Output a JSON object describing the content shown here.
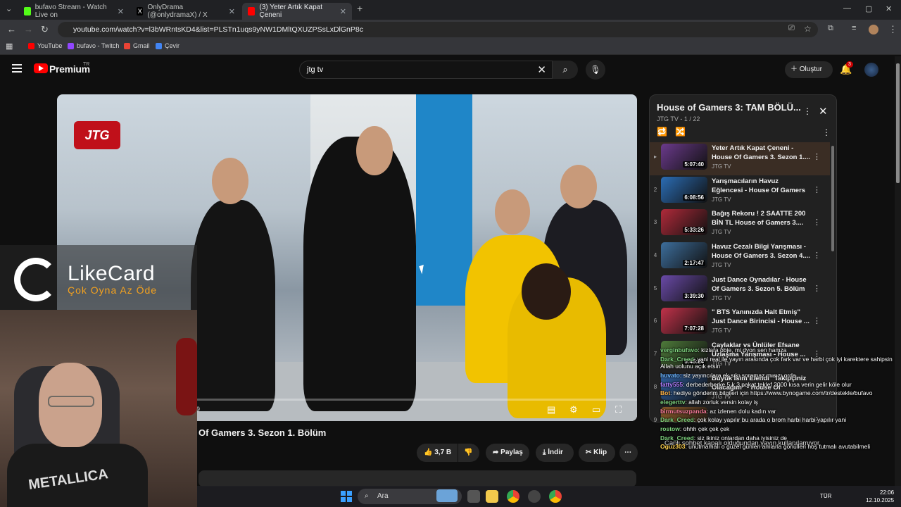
{
  "browser": {
    "tabs": [
      {
        "title": "bufavo Stream - Watch Live on",
        "color": "#53fc18"
      },
      {
        "title": "OnlyDrama (@onlydramaX) / X",
        "color": "#ffffff"
      },
      {
        "title": "(3) Yeter Artık Kapat Çeneni",
        "color": "#ff0000"
      }
    ],
    "url": "youtube.com/watch?v=l3bWRntsKD4&list=PLSTn1uqs9yNW1DMltQXUZPSsLxDlGnP8c",
    "bookmarks": [
      {
        "label": "YouTube",
        "color": "#ff0000"
      },
      {
        "label": "bufavo - Twitch",
        "color": "#9146ff"
      },
      {
        "label": "Gmail",
        "color": "#ea4335"
      },
      {
        "label": "Çevir",
        "color": "#4285f4"
      }
    ]
  },
  "yt": {
    "brand": "Premium",
    "region": "TR",
    "search_value": "jtg tv",
    "create_label": "Oluştur",
    "notif_count": "3"
  },
  "video": {
    "title": "Of Gamers 3. Sezon 1. Bölüm",
    "time_hint": "9",
    "logo_text": "JTG",
    "progress": 0.01,
    "actions": {
      "likes": "3,7 B",
      "share": "Paylaş",
      "download": "İndir",
      "clip": "Klip"
    }
  },
  "playlist": {
    "title": "House of Gamers 3: TAM BÖLÜ...",
    "sub": "JTG TV - 1 / 22",
    "items": [
      {
        "idx": "▸",
        "title": "Yeter Artık Kapat Çeneni - House Of Gamers 3. Sezon 1....",
        "channel": "JTG TV",
        "duration": "5:07:40",
        "thumb": "#6b3a8c"
      },
      {
        "idx": "2",
        "title": "Yarışmacıların Havuz Eğlencesi - House Of Gamers 3. Sezon ...",
        "channel": "JTG TV",
        "duration": "6:08:56",
        "thumb": "#2b6db5"
      },
      {
        "idx": "3",
        "title": "Bağış Rekoru ! 2 SAATTE 200 BİN TL House of Gamers 3....",
        "channel": "JTG TV",
        "duration": "5:33:26",
        "thumb": "#b02a3a"
      },
      {
        "idx": "4",
        "title": "Havuz Cezalı Bilgi Yarışması - House Of Gamers 3. Sezon 4....",
        "channel": "JTG TV",
        "duration": "2:17:47",
        "thumb": "#3d6e9c"
      },
      {
        "idx": "5",
        "title": "Just Dance Oynadılar - House Of Gamers 3. Sezon 5. Bölüm",
        "channel": "JTG TV",
        "duration": "3:39:30",
        "thumb": "#6a4aa8"
      },
      {
        "idx": "6",
        "title": "\" BTS Yanınızda Halt Etmiş\" Just Dance Birincisi - House ...",
        "channel": "JTG TV",
        "duration": "7:07:28",
        "thumb": "#c2324a"
      },
      {
        "idx": "7",
        "title": "Çaylaklar vs Ünlüler Efsane Uzlaşma Yarışması - House ...",
        "channel": "JTG TV",
        "duration": "5:45:24",
        "thumb": "#4e7a3a"
      },
      {
        "idx": "8",
        "title": "Büyük İsim Elendi \"Takipçiniz Olacağım\" - House Of Gamers...",
        "channel": "JTG TV",
        "duration": "",
        "thumb": "#2f5f9e"
      },
      {
        "idx": "9",
        "title": "",
        "channel": "",
        "duration": "",
        "thumb": "#8a5a2a"
      }
    ]
  },
  "overlay": {
    "sponsor_name": "LikeCard",
    "sponsor_tag": "Çok Oyna  Az Öde",
    "shirt_text": "METALLICA",
    "live_note": "Canlı sohbet kapalı olduğundan yayın kullanılamıyor.",
    "chat": [
      {
        "user": "verginbufavo",
        "color": "#7fd47f",
        "msg": ": kizlara obje, mi dyon sen hamza"
      },
      {
        "user": "Dark_Creed",
        "color": "#7fd47f",
        "msg": ": yani real ile yayın arasında çok fark var ve harbi çok iyi karektere sahipsin Allah uolunu açık etsin"
      },
      {
        "user": "huvato",
        "color": "#6fb7ff",
        "msg": ": siz yayıncılara ek sıkı soramaz mısızı orda"
      },
      {
        "user": "fatty555",
        "color": "#b57fff",
        "msg": ": derbederberke 5 k 3 pakat teklef 2000 kısa verin gelir köle olur"
      },
      {
        "user": "Bot",
        "color": "#ffb347",
        "msg": ": hediye gönderim bilgileri için https://www.bynogame.com/tr/destekle/bufavo"
      },
      {
        "user": "elegerttv",
        "color": "#7fd47f",
        "msg": ": allah zorluk versin kolay iş"
      },
      {
        "user": "birmutsuzpanda",
        "color": "#ff7f9f",
        "msg": ": az izlenen dolu kadın var"
      },
      {
        "user": "Dark_Creed",
        "color": "#7fd47f",
        "msg": ": çok kolay yapılır bu arada o brom harbi harbi yapılır yani"
      },
      {
        "user": "rostow",
        "color": "#7fd47f",
        "msg": ": ohhh çek çek çek"
      },
      {
        "user": "Dark_Creed",
        "color": "#7fd47f",
        "msg": ": siz ikiniz onlardan daha iyisiniz de"
      },
      {
        "user": "Oguz303",
        "color": "#ffd24f",
        "msg": ": unutmamalı o güzel günleri anılarla gönülleri hoş tutmalı avutabilmeli"
      }
    ]
  },
  "taskbar": {
    "search_label": "Ara",
    "time": "22:06",
    "date": "12.10.2025",
    "lang": "TÜR"
  },
  "colors": {
    "accent": "#ff0000",
    "bg": "#0f0f0f"
  }
}
